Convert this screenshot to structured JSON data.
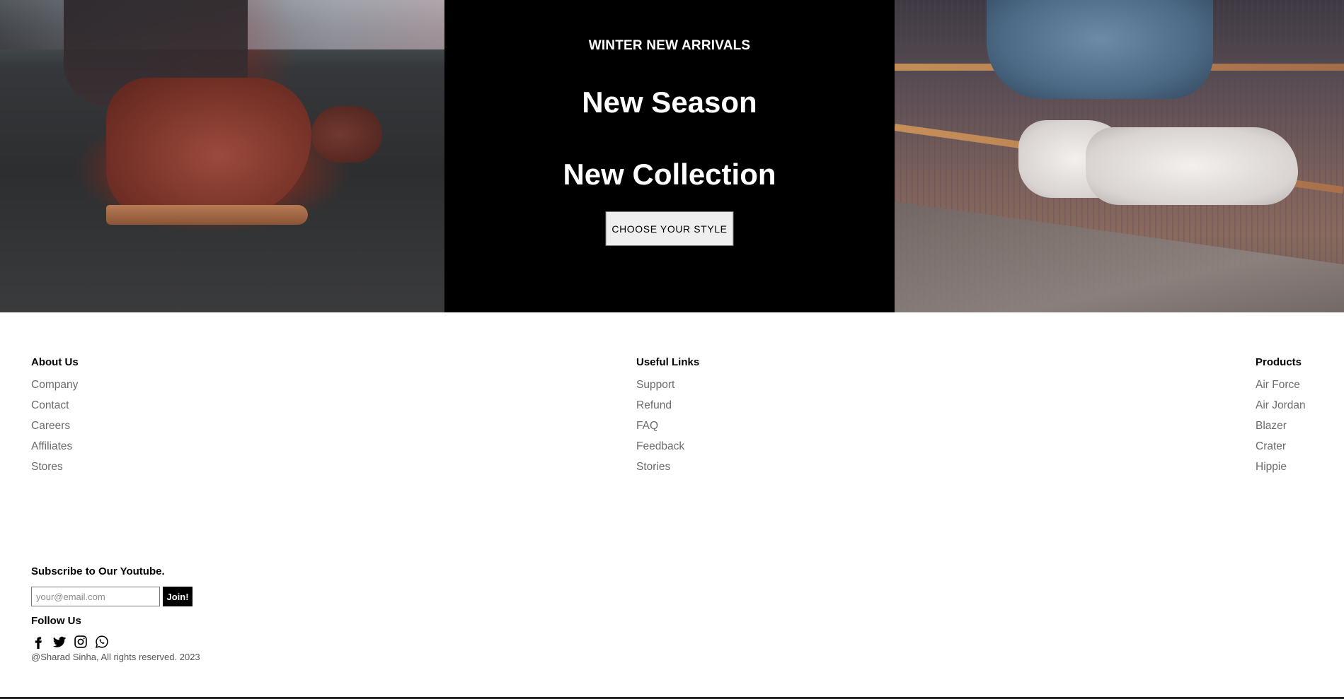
{
  "hero": {
    "eyebrow": "WINTER NEW ARRIVALS",
    "headline_1": "New Season",
    "headline_2": "New Collection",
    "cta_label": "CHOOSE YOUR STYLE",
    "left_image": "boot-photo",
    "right_image": "sneaker-photo"
  },
  "footer": {
    "about": {
      "heading": "About Us",
      "links": [
        "Company",
        "Contact",
        "Careers",
        "Affiliates",
        "Stores"
      ]
    },
    "useful": {
      "heading": "Useful Links",
      "links": [
        "Support",
        "Refund",
        "FAQ",
        "Feedback",
        "Stories"
      ]
    },
    "products": {
      "heading": "Products",
      "links": [
        "Air Force",
        "Air Jordan",
        "Blazer",
        "Crater",
        "Hippie"
      ]
    },
    "subscribe": {
      "title": "Subscribe to Our Youtube.",
      "placeholder": "your@email.com",
      "button_label": "Join!"
    },
    "follow": {
      "title": "Follow Us",
      "icons": [
        "facebook-icon",
        "twitter-icon",
        "instagram-icon",
        "whatsapp-icon"
      ]
    },
    "copyright": "@Sharad Sinha, All rights reserved. 2023"
  },
  "colors": {
    "hero_mid_bg": "#000000",
    "text_primary": "#000000",
    "link_gray": "#6b6b6b",
    "button_light": "#efefef"
  }
}
